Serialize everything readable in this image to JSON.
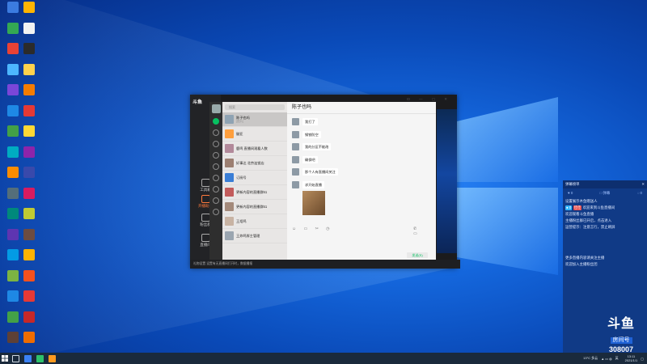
{
  "desktop": {
    "icon_colors": [
      "#3b7be0",
      "#ffb400",
      "#34a853",
      "#f2f2f2",
      "#e94235",
      "#2b2b2b",
      "#4db6ff",
      "#ffd24d",
      "#7a46d8",
      "#f57c00",
      "#1e88e5",
      "#e53935",
      "#43a047",
      "#fdd835",
      "#00acc1",
      "#8e24aa",
      "#fb8c00",
      "#3949ab",
      "#546e7a",
      "#d81b60",
      "#00897b",
      "#c0ca33",
      "#5e35b1",
      "#6d4c41",
      "#039be5",
      "#ffb300",
      "#7cb342",
      "#f4511e",
      "#1e88e5",
      "#e53935",
      "#43a047",
      "#c62828",
      "#5d4037",
      "#ef6c00",
      "#1565c0",
      "#2e7d32"
    ]
  },
  "wechat": {
    "douyu_brand": "斗鱼",
    "side_items": [
      "工具箱",
      "开播助手",
      "粉丝群",
      "直播间"
    ],
    "search_placeholder": "搜索",
    "add_button": "+",
    "chats": [
      {
        "name": "陈子也吗",
        "preview": "[图片]",
        "avatar_color": "#8fa3b3",
        "selected": true
      },
      {
        "name": "徽亚",
        "preview": "",
        "avatar_color": "#ff9f3d",
        "selected": false
      },
      {
        "name": "鹿鸣  直播间观看人数",
        "preview": "",
        "avatar_color": "#b2899a",
        "selected": false
      },
      {
        "name": "好事达  北京连锁店",
        "preview": "",
        "avatar_color": "#9c7f71",
        "selected": false
      },
      {
        "name": "订阅号",
        "preview": "",
        "avatar_color": "#3a7ed6",
        "selected": false
      },
      {
        "name": "更新内容的直播群51",
        "preview": "",
        "avatar_color": "#c25b5b",
        "selected": false
      },
      {
        "name": "更新内容的直播群51",
        "preview": "",
        "avatar_color": "#a48a7b",
        "selected": false
      },
      {
        "name": "王炬鸣",
        "preview": "",
        "avatar_color": "#c8b3a3",
        "selected": false
      },
      {
        "name": "王炸鸣胖主管理",
        "preview": "",
        "avatar_color": "#9aa5b0",
        "selected": false
      }
    ],
    "chat_title": "陈子也吗",
    "messages": [
      "我打了",
      "钢铁防空",
      "我的分区不能改",
      "确保吧",
      "那个人有直播间关注",
      "求开始直播"
    ],
    "tools": "☺ ▭ ✂ ◷",
    "tools_right": "✆ ▭",
    "send_label": "发送(S)",
    "window_controls": "⊡ — ▢ ✕",
    "douyu_footer": "礼物设置    设置有无直播间打开时，数据播报"
  },
  "stream_panel": {
    "header_left": "弹幕榜单",
    "header_right": "✕",
    "gifts": [
      "♥ 0",
      "□ 弹幕",
      "◌ 0"
    ],
    "messages": [
      {
        "text": "设置展示木鱼赠送人",
        "badge": "",
        "badge2": ""
      },
      {
        "text": "欢迎来到斗鱼直播间",
        "badge": "● 0",
        "badge2": "佳佳"
      },
      {
        "text": "欢迎观看斗鱼直播",
        "badge": "",
        "badge2": ""
      },
      {
        "text": "主播粉丝群已开启，点击进入",
        "badge": "",
        "badge2": ""
      },
      {
        "text": "运营提示：注意言行，禁止刷屏",
        "badge": "",
        "badge2": ""
      },
      {
        "text": "更多直播内容请关注主播",
        "badge": "",
        "badge2": ""
      },
      {
        "text": "欢迎加入主播粉丝团",
        "badge": "",
        "badge2": ""
      }
    ],
    "room_logo": "斗鱼",
    "room_label": "房间号",
    "room_number": "308007"
  },
  "taskbar": {
    "weather": "13°C 多云",
    "ime": "英",
    "time": "13:11",
    "date": "2021/1/1"
  }
}
